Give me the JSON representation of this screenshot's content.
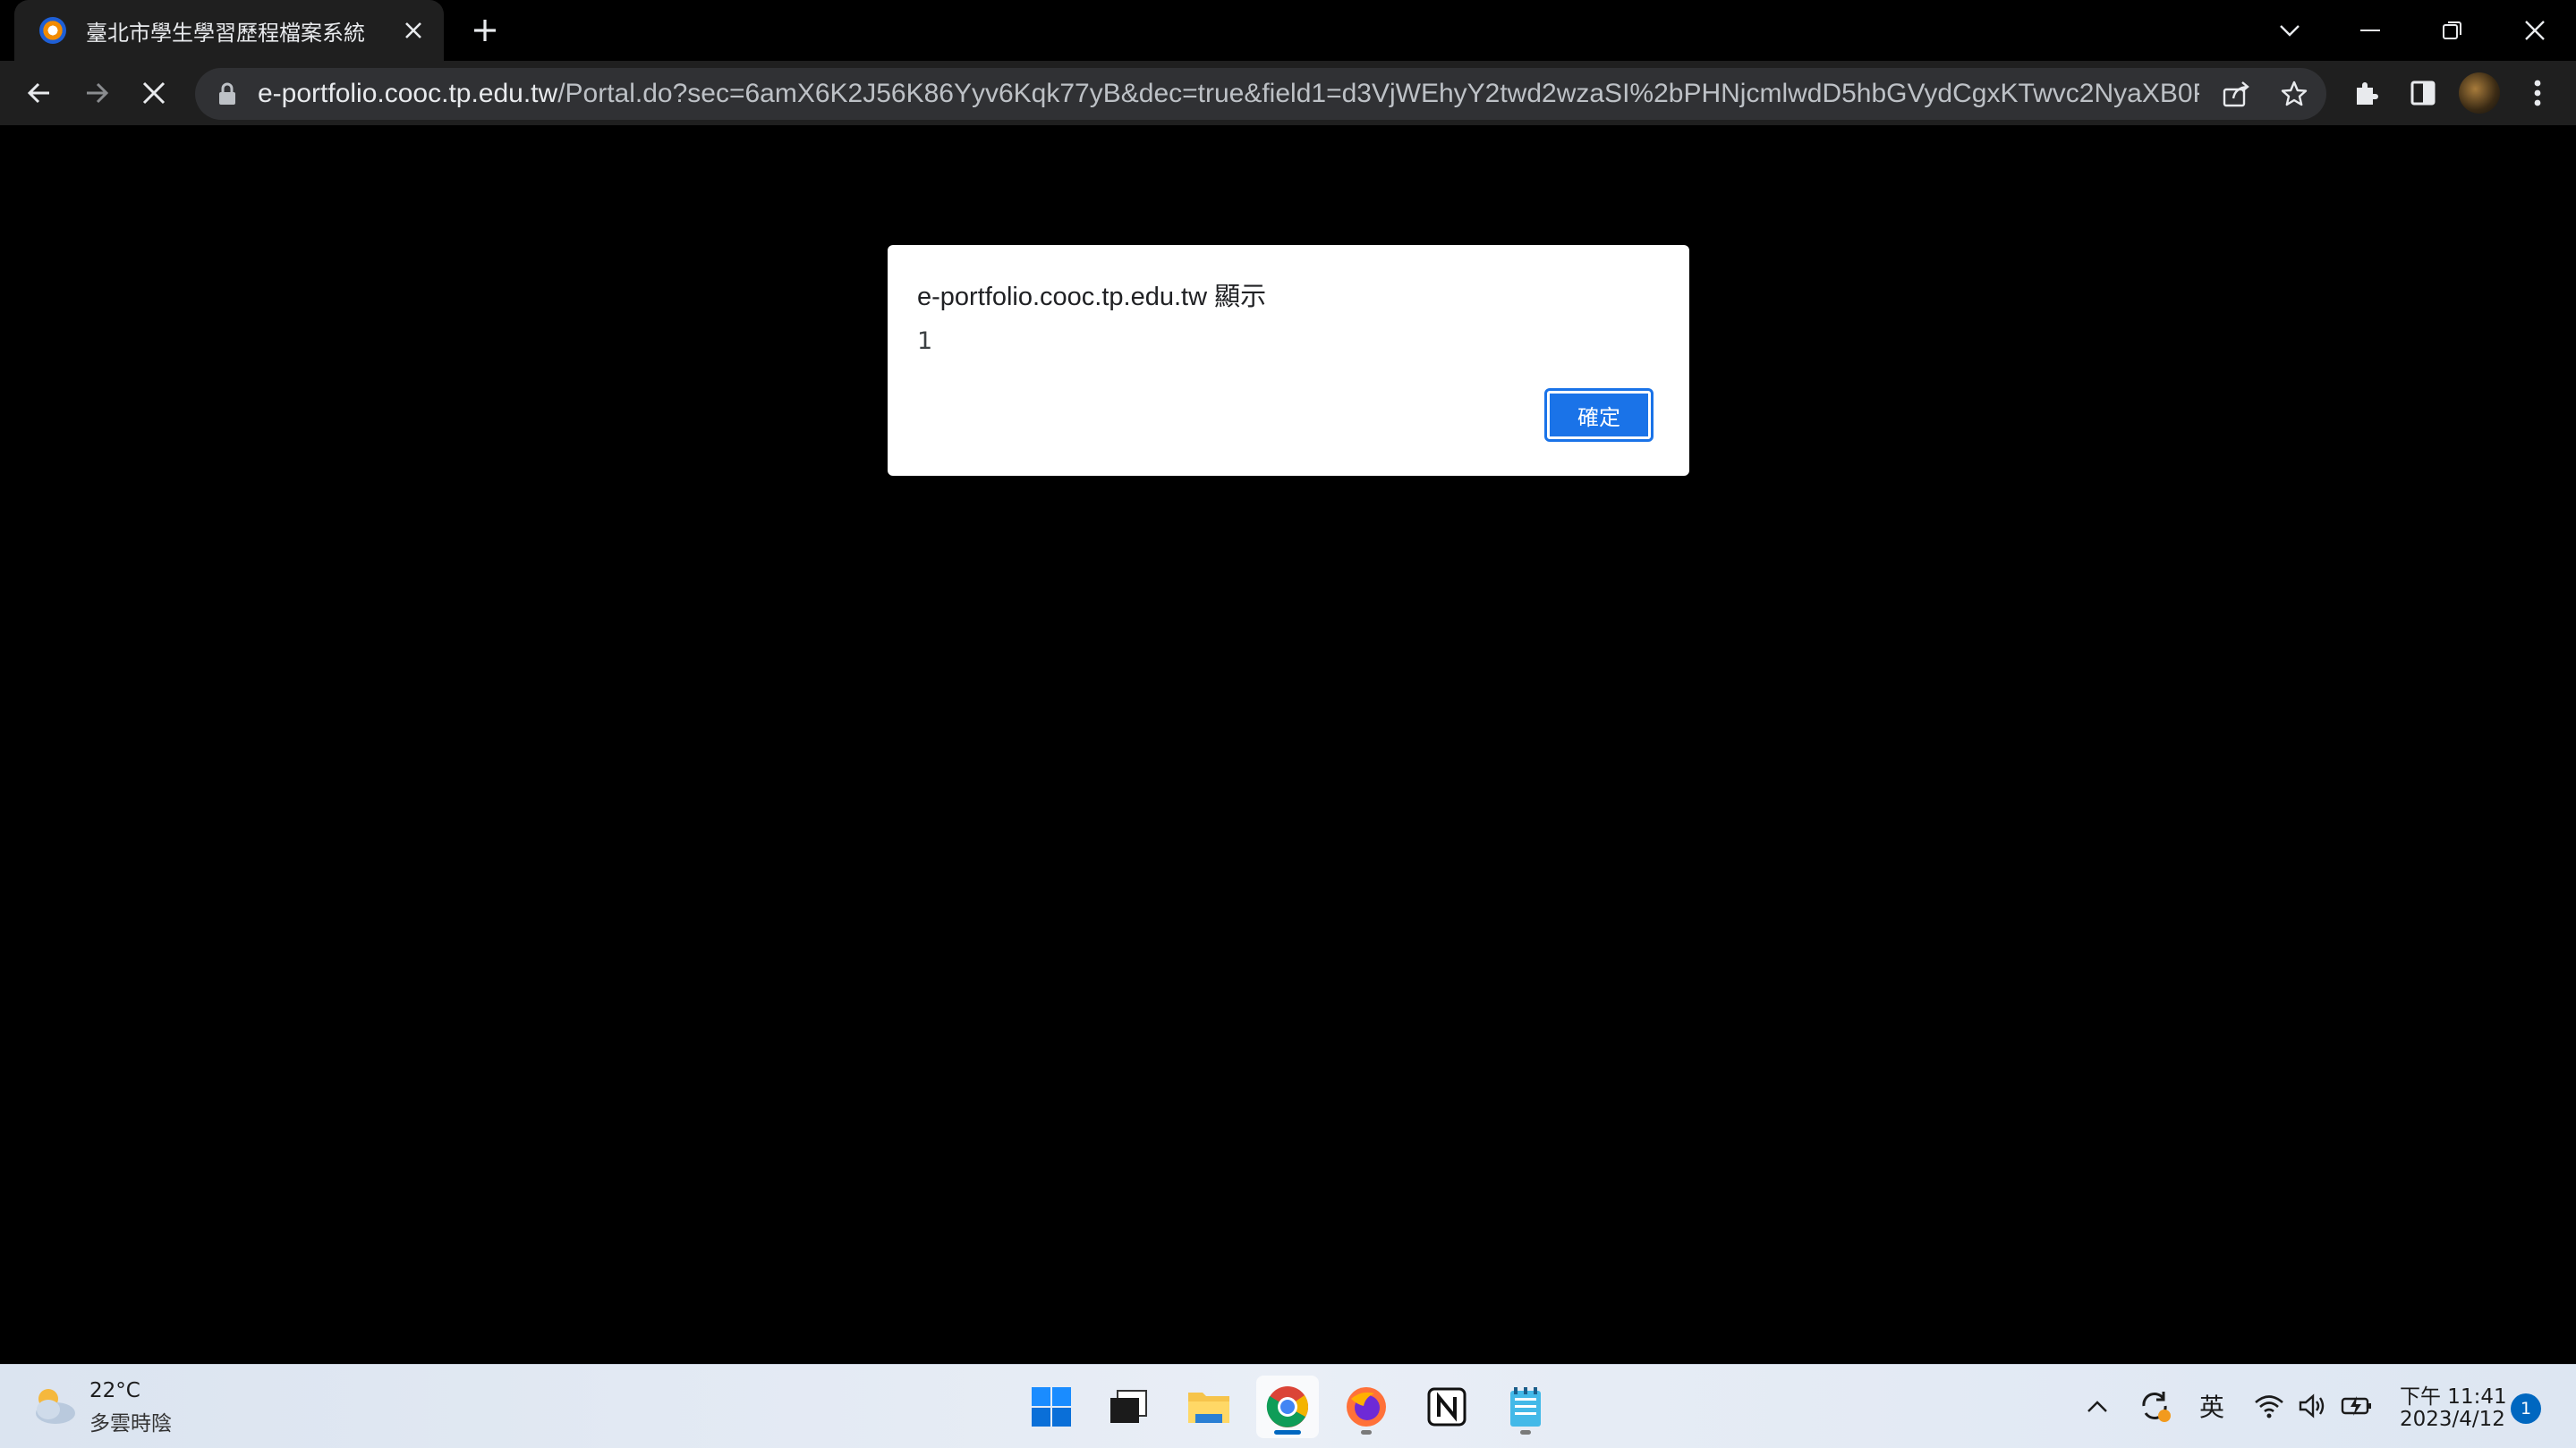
{
  "browser": {
    "tab_title": "臺北市學生學習歷程檔案系統",
    "url_host": "e-portfolio.cooc.tp.edu.tw",
    "url_path": "/Portal.do?sec=6amX6K2J56K86Yyv6Kqk77yB&dec=true&field1=d3VjWEhyY2twd2wzaSI%2bPHNjcmlwdD5hbGVydCgxKTwvc2NyaXB0P..."
  },
  "dialog": {
    "title": "e-portfolio.cooc.tp.edu.tw 顯示",
    "message": "1",
    "ok_label": "確定"
  },
  "taskbar": {
    "weather_temp": "22°C",
    "weather_desc": "多雲時陰",
    "ime": "英",
    "time": "下午 11:41",
    "date": "2023/4/12",
    "notifications": "1",
    "apps": [
      "start",
      "task-view",
      "file-explorer",
      "chrome",
      "firefox",
      "notion",
      "notepad"
    ]
  },
  "colors": {
    "dialog_button": "#1a73e8",
    "chrome_toolbar": "#1f1f1f",
    "taskbar_bg": "#e9eef6"
  }
}
